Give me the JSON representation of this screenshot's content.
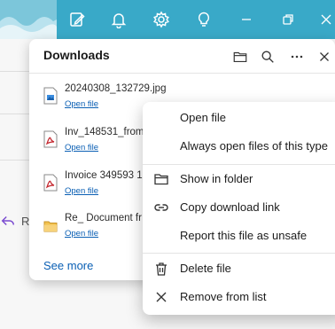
{
  "toolbar": {
    "icons": [
      "edit-icon",
      "bell-icon",
      "gear-icon",
      "lightbulb-icon",
      "minimize-icon",
      "restore-icon",
      "close-icon"
    ]
  },
  "background": {
    "reply_text": "R"
  },
  "downloads": {
    "title": "Downloads",
    "actions": [
      "open-folder-icon",
      "search-icon",
      "more-icon",
      "close-icon"
    ],
    "items": [
      {
        "name": "20240308_132729.jpg",
        "link": "Open file",
        "icon": "image-file-icon"
      },
      {
        "name": "Inv_148531_from",
        "link": "Open file",
        "icon": "pdf-file-icon"
      },
      {
        "name": "Invoice 349593 1",
        "link": "Open file",
        "icon": "pdf-file-icon"
      },
      {
        "name": "Re_ Document fr",
        "link": "Open file",
        "icon": "folder-file-icon"
      }
    ],
    "see_more": "See more"
  },
  "context_menu": {
    "open_file": "Open file",
    "always_open": "Always open files of this type",
    "show_in_folder": "Show in folder",
    "copy_link": "Copy download link",
    "report_unsafe": "Report this file as unsafe",
    "delete_file": "Delete file",
    "remove_from_list": "Remove from list"
  },
  "colors": {
    "accent_bar": "#39a9c8",
    "link": "#0a5fb4",
    "pdf_red": "#c4262e"
  }
}
